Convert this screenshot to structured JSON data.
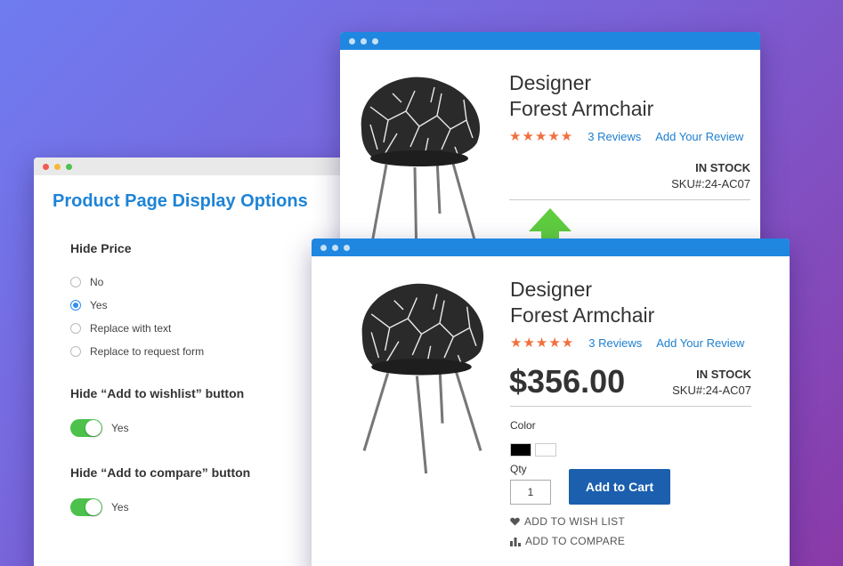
{
  "options_window": {
    "title": "Product Page Display Options",
    "hide_price": {
      "label": "Hide Price",
      "options": [
        "No",
        "Yes",
        "Replace with text",
        "Replace to request form"
      ],
      "selected": "Yes"
    },
    "hide_wishlist": {
      "label": "Hide “Add to wishlist” button",
      "value": "Yes"
    },
    "hide_compare": {
      "label": "Hide “Add to compare” button",
      "value": "Yes"
    },
    "titlebar_dot_colors": [
      "#f25b53",
      "#f5b83a",
      "#4fc24f"
    ]
  },
  "product_before": {
    "name_line1": "Designer",
    "name_line2": "Forest Armchair",
    "stars": "★★★★★",
    "reviews_link": "3 Reviews",
    "add_review_link": "Add Your Review",
    "stock": "IN STOCK",
    "sku": "SKU#:24-AC07"
  },
  "product_after": {
    "name_line1": "Designer",
    "name_line2": "Forest Armchair",
    "stars": "★★★★★",
    "reviews_link": "3 Reviews",
    "add_review_link": "Add Your Review",
    "price": "$356.00",
    "stock": "IN STOCK",
    "sku": "SKU#:24-AC07",
    "color_label": "Color",
    "swatches": [
      "#000000",
      "#ffffff"
    ],
    "qty_label": "Qty",
    "qty_value": "1",
    "add_to_cart": "Add to Cart",
    "wishlist": "ADD TO WISH LIST",
    "compare": "ADD TO COMPARE"
  },
  "colors": {
    "accent_blue": "#1e84d6",
    "star_orange": "#f26f3c",
    "cart_blue": "#1b5fae",
    "arrow_green": "#5fcc3f"
  }
}
